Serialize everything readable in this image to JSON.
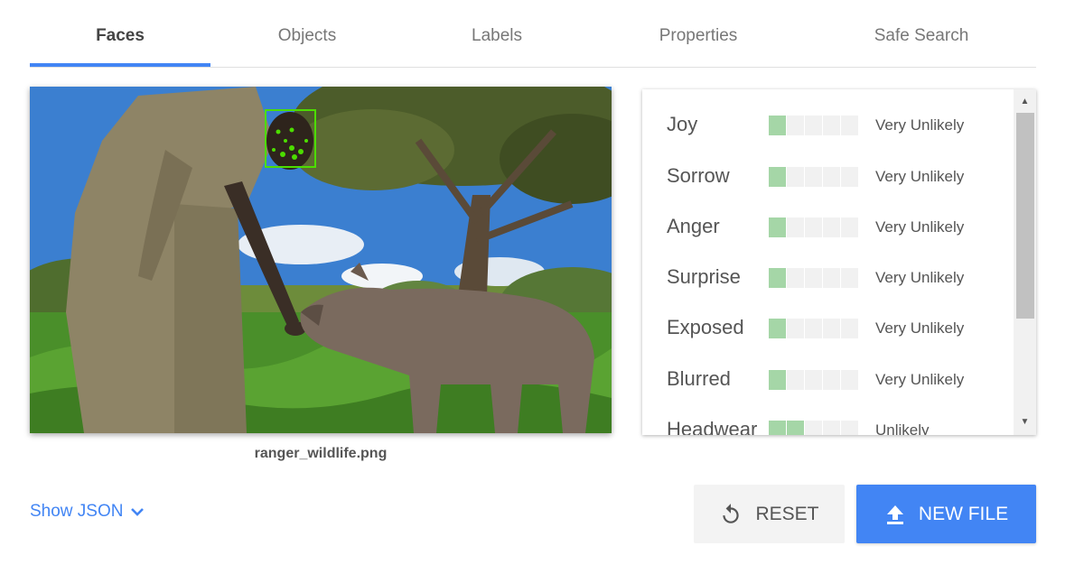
{
  "tabs": [
    {
      "label": "Faces",
      "active": true
    },
    {
      "label": "Objects",
      "active": false
    },
    {
      "label": "Labels",
      "active": false
    },
    {
      "label": "Properties",
      "active": false
    },
    {
      "label": "Safe Search",
      "active": false
    }
  ],
  "image": {
    "filename": "ranger_wildlife.png",
    "face_box_color": "#4cdd00"
  },
  "likelihoods": [
    {
      "label": "Joy",
      "value": "Very Unlikely",
      "level": 1
    },
    {
      "label": "Sorrow",
      "value": "Very Unlikely",
      "level": 1
    },
    {
      "label": "Anger",
      "value": "Very Unlikely",
      "level": 1
    },
    {
      "label": "Surprise",
      "value": "Very Unlikely",
      "level": 1
    },
    {
      "label": "Exposed",
      "value": "Very Unlikely",
      "level": 1
    },
    {
      "label": "Blurred",
      "value": "Very Unlikely",
      "level": 1
    },
    {
      "label": "Headwear",
      "value": "Unlikely",
      "level": 2
    }
  ],
  "meter_max": 5,
  "colors": {
    "accent": "#4285f4",
    "meter_on": "#a5d6a7",
    "meter_off": "#f1f1f1"
  },
  "actions": {
    "show_json": "Show JSON",
    "reset": "RESET",
    "new_file": "NEW FILE"
  },
  "icons": {
    "show_json": "chevron-down-icon",
    "reset": "reset-icon",
    "new_file": "upload-icon"
  }
}
